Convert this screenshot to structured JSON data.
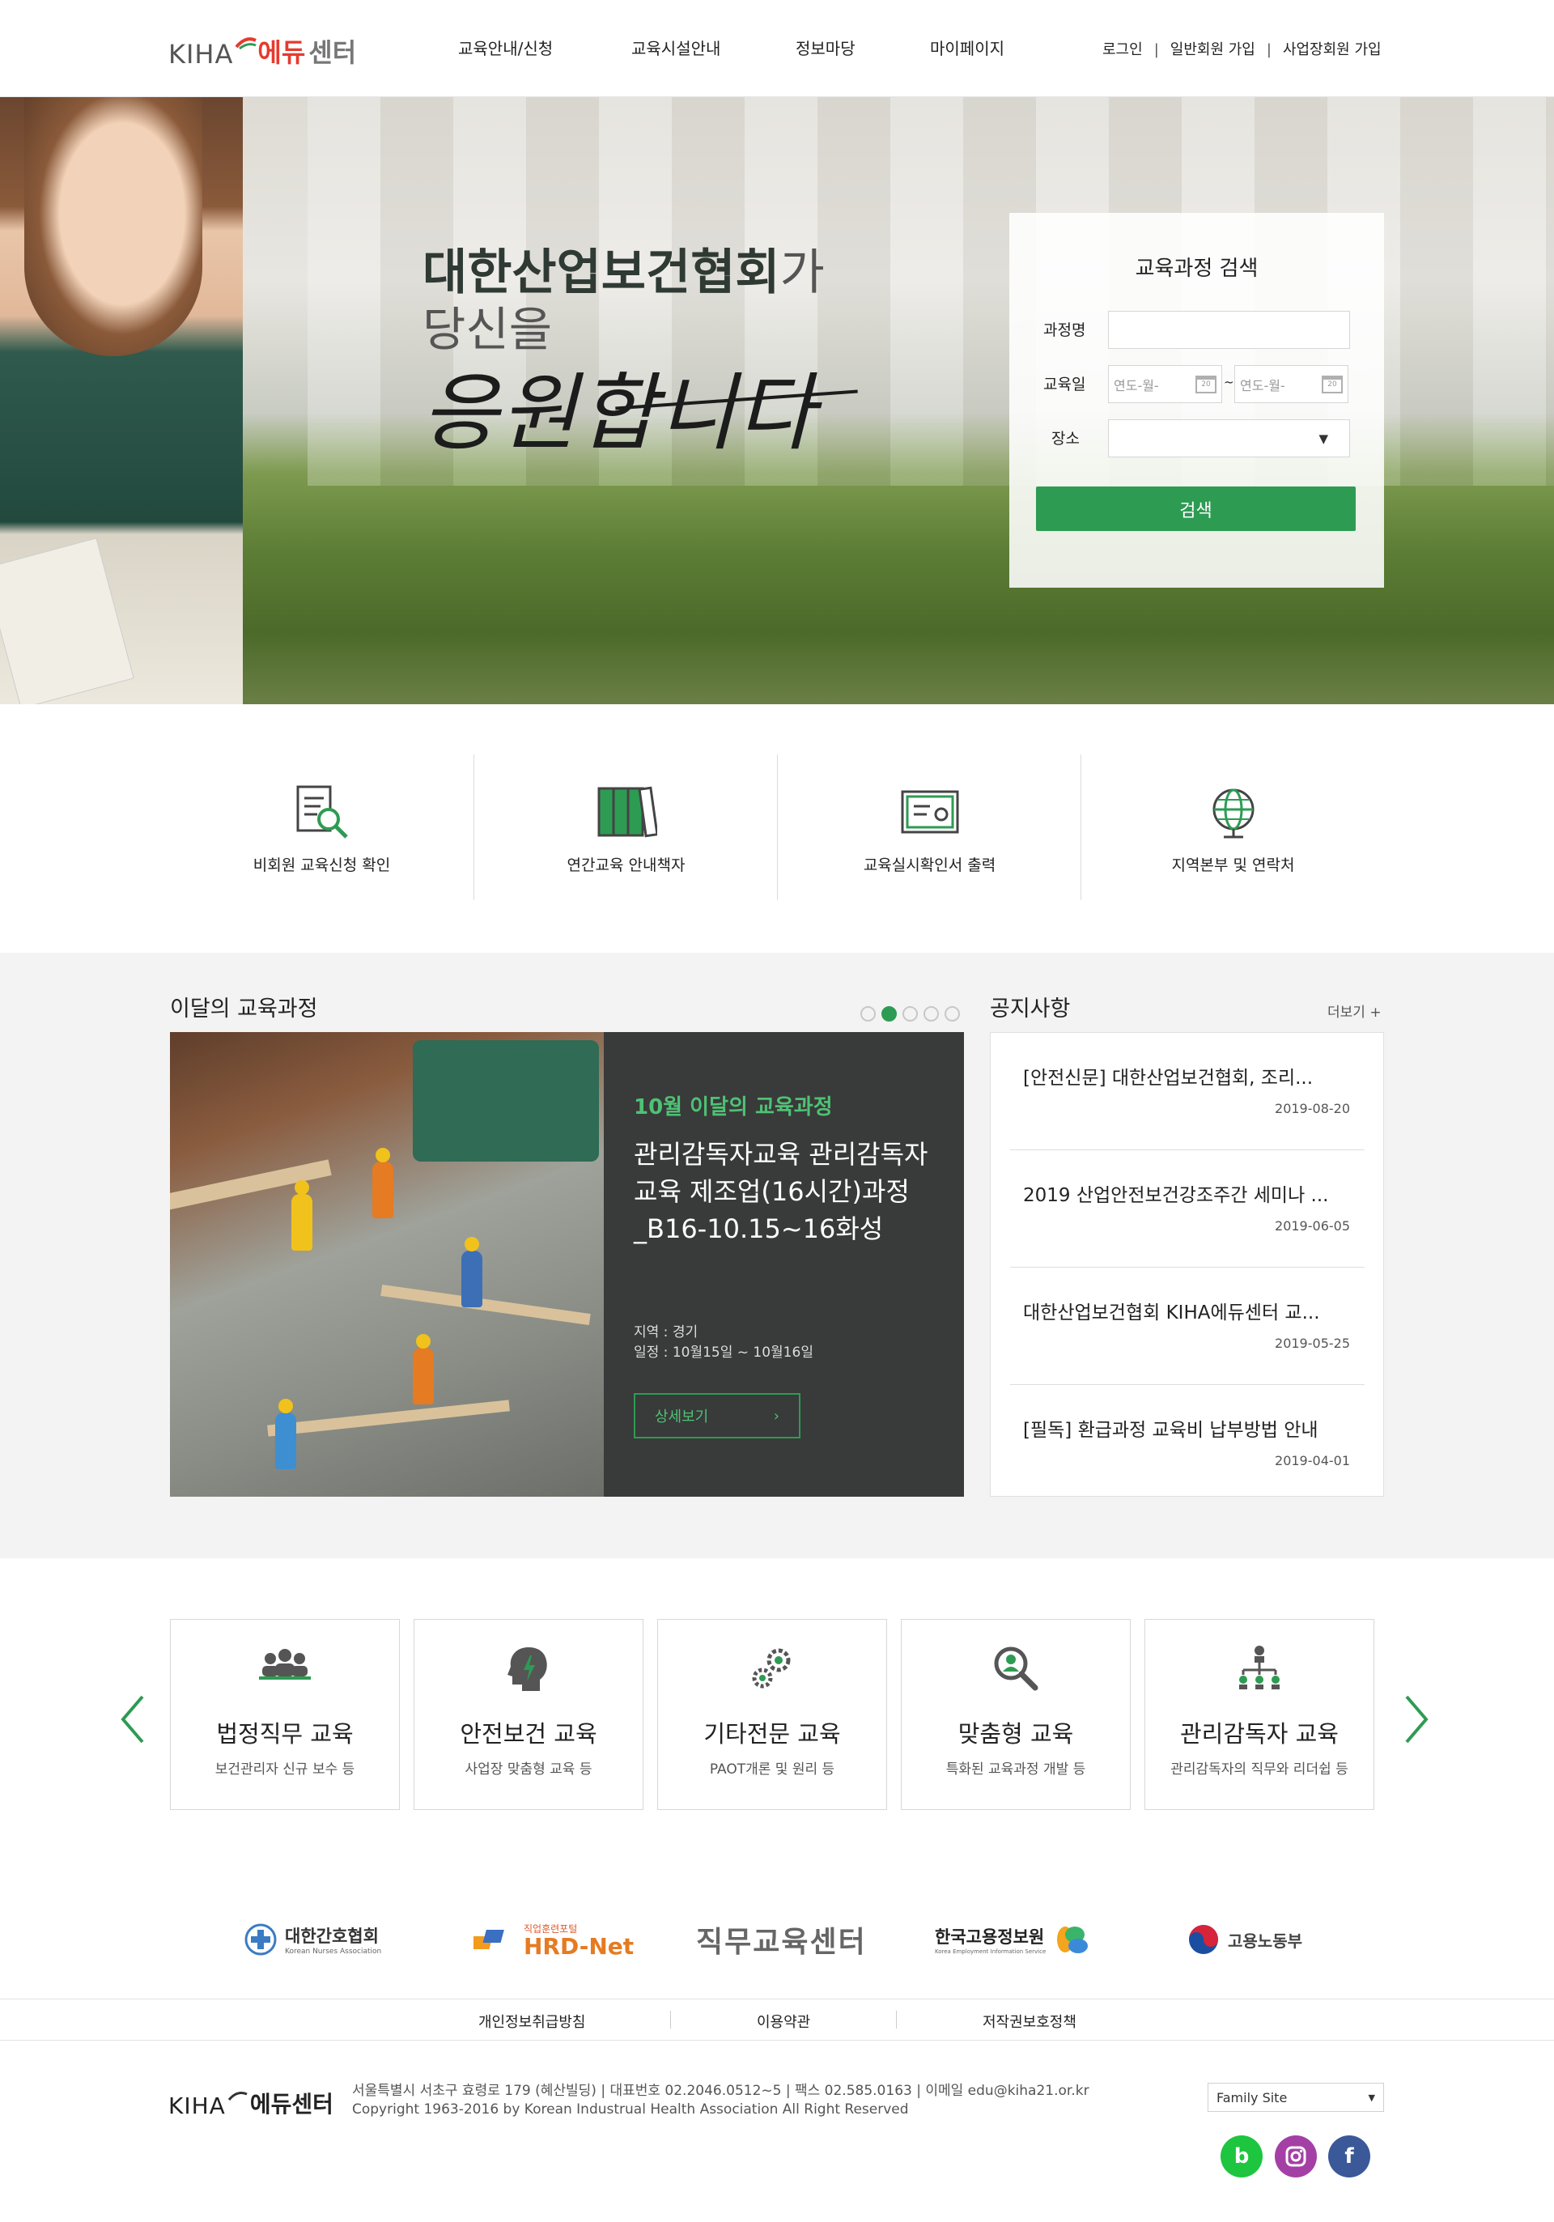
{
  "header": {
    "logo_en": "KIHA",
    "logo_ko_red": "에듀",
    "logo_ko_gray": "센터",
    "nav": [
      "교육안내/신청",
      "교육시설안내",
      "정보마당",
      "마이페이지"
    ],
    "util": [
      "로그인",
      "일반회원 가입",
      "사업장회원 가입"
    ],
    "util_sep": "|"
  },
  "hero": {
    "line1_bold": "대한산업보건협회",
    "line1_light": "가",
    "line2": "당신을",
    "script": "응원합니다"
  },
  "search": {
    "title": "교육과정 검색",
    "course_label": "과정명",
    "course_value": "",
    "date_label": "교육일",
    "date_from_placeholder": "연도-월-",
    "date_sep": "~",
    "date_to_placeholder": "연도-월-",
    "place_label": "장소",
    "place_value": "",
    "button": "검색"
  },
  "quick_links": [
    {
      "label": "비회원 교육신청 확인",
      "icon": "document-search-icon"
    },
    {
      "label": "연간교육 안내책자",
      "icon": "books-icon"
    },
    {
      "label": "교육실시확인서 출력",
      "icon": "certificate-icon"
    },
    {
      "label": "지역본부 및 연락처",
      "icon": "globe-icon"
    }
  ],
  "monthly": {
    "title": "이달의 교육과정",
    "slide_count": 5,
    "active_slide": 2,
    "month_label": "10월 이달의 교육과정",
    "course_title": "관리감독자교육 관리감독자교육 제조업(16시간)과정_B16-10.15~16화성",
    "region": "지역 : 경기",
    "schedule": "일정 : 10월15일 ~ 10월16일",
    "detail_button": "상세보기",
    "detail_arrow": "›"
  },
  "notice": {
    "title": "공지사항",
    "more": "더보기 +",
    "items": [
      {
        "title": "[안전신문] 대한산업보건협회, 조리...",
        "date": "2019-08-20"
      },
      {
        "title": "2019 산업안전보건강조주간 세미나 ...",
        "date": "2019-06-05"
      },
      {
        "title": "대한산업보건협회 KIHA에듀센터 교...",
        "date": "2019-05-25"
      },
      {
        "title": "[필독] 환급과정 교육비 납부방법 안내",
        "date": "2019-04-01"
      }
    ]
  },
  "categories": [
    {
      "title": "법정직무 교육",
      "sub": "보건관리자 신규 보수 등",
      "icon": "group-icon"
    },
    {
      "title": "안전보건 교육",
      "sub": "사업장 맞춤형 교육 등",
      "icon": "head-bolt-icon"
    },
    {
      "title": "기타전문 교육",
      "sub": "PAOT개론 및 원리 등",
      "icon": "gears-icon"
    },
    {
      "title": "맞춤형 교육",
      "sub": "특화된 교육과정 개발 등",
      "icon": "magnifier-user-icon"
    },
    {
      "title": "관리감독자 교육",
      "sub": "관리감독자의 직무와 리더쉽 등",
      "icon": "org-chart-icon"
    }
  ],
  "partners": {
    "nurses": "대한간호협회",
    "nurses_en": "Korean Nurses Association",
    "hrd_small": "직업훈련포털",
    "hrd": "HRD-Net",
    "job_center": "직무교육센터",
    "keis": "한국고용정보원",
    "keis_en": "Korea Employment Information Service",
    "moel": "고용노동부"
  },
  "footer": {
    "links": [
      "개인정보취급방침",
      "이용약관",
      "저작권보호정책"
    ],
    "logo_en": "KIHA",
    "logo_ko": "에듀센터",
    "address": "서울특별시 서초구 효령로 179 (혜산빌딩)   |   대표번호 02.2046.0512~5   |   팩스 02.585.0163   |   이메일 edu@kiha21.or.kr",
    "copyright": "Copyright 1963-2016 by Korean Industrual Health Association All Right Reserved",
    "family_site": "Family Site",
    "colors": {
      "brand_green": "#2e9b53",
      "naver_band": "#1ec53f",
      "instagram": "#a43fa5",
      "facebook": "#3b5998"
    }
  }
}
